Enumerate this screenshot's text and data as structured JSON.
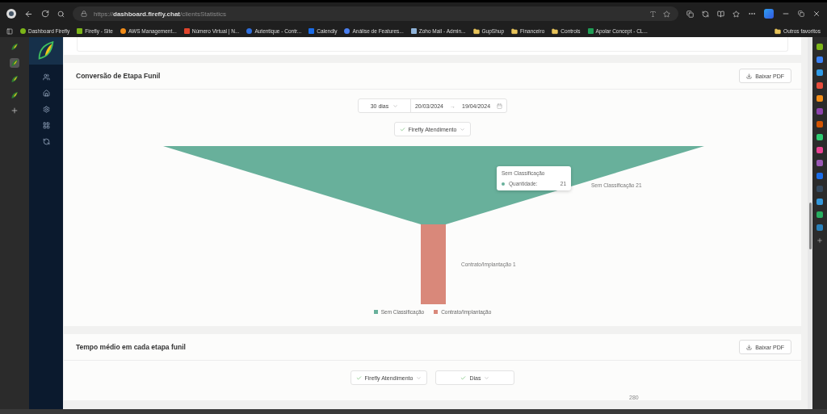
{
  "browser": {
    "url": "https://**dashboard.firefly.chat**/clientsStatistics"
  },
  "bookmarks": [
    {
      "label": "Dashboard Firefly",
      "kind": "site",
      "color": "#7cb518"
    },
    {
      "label": "Firefly - Site",
      "kind": "site",
      "color": "#7cb518"
    },
    {
      "label": "AWS Management...",
      "kind": "site",
      "color": "#f28c18"
    },
    {
      "label": "Número Virtual | N...",
      "kind": "site",
      "color": "#e0442c"
    },
    {
      "label": "Autentique - Contr...",
      "kind": "site",
      "color": "#2f6fdd"
    },
    {
      "label": "Calendly",
      "kind": "site",
      "color": "#1a6ce8"
    },
    {
      "label": "Análise de Features...",
      "kind": "site",
      "color": "#4a7ff0"
    },
    {
      "label": "Zoho Mail - Admin...",
      "kind": "site",
      "color": "#8fb3d9"
    },
    {
      "label": "GupShup",
      "kind": "folder",
      "color": "#e8c45a"
    },
    {
      "label": "Financeiro",
      "kind": "folder",
      "color": "#e8c45a"
    },
    {
      "label": "Controls",
      "kind": "folder",
      "color": "#e8c45a"
    },
    {
      "label": "Apolar Concept - CL...",
      "kind": "site",
      "color": "#1f9d55"
    }
  ],
  "other_bookmarks": "Outros favoritos",
  "vertical_tabs": [
    {
      "selected": false
    },
    {
      "selected": true
    },
    {
      "selected": false
    },
    {
      "selected": false
    }
  ],
  "funnel_card": {
    "title": "Conversão de Etapa Funil",
    "download": "Baixar PDF",
    "period": "30 dias",
    "date_from": "20/03/2024",
    "date_arrow": "→",
    "date_to": "19/04/2024",
    "channel": "Firefly Atendimento",
    "stages": [
      {
        "name": "Sem Classificação",
        "label": "Sem Classificação 21",
        "color": "#68b09b"
      },
      {
        "name": "Contrato/Implantação",
        "label": "Contrato/Implantação 1",
        "color": "#d9887a"
      }
    ],
    "tooltip": {
      "title": "Sem Classificação",
      "key": "Quantidade:",
      "value": "21"
    }
  },
  "time_card": {
    "title": "Tempo médio em cada etapa funil",
    "download": "Baixar PDF",
    "channel": "Firefly Atendimento",
    "unit": "Dias",
    "axis_peek": "280"
  }
}
